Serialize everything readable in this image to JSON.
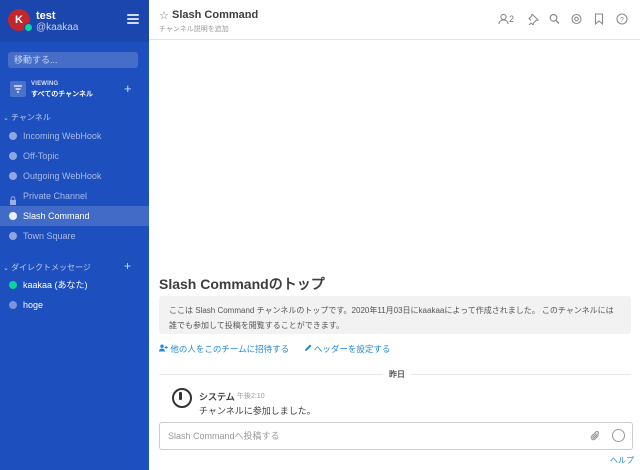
{
  "sidebar": {
    "avatar_initial": "K",
    "team_name": "test",
    "user_handle": "@kaakaa",
    "search_placeholder": "移動する...",
    "viewing_small": "VIEWING",
    "viewing_label": "すべてのチャンネル",
    "channels_title": "チャンネル",
    "channels": [
      {
        "label": "Incoming WebHook",
        "type": "public",
        "active": false
      },
      {
        "label": "Off-Topic",
        "type": "public",
        "active": false
      },
      {
        "label": "Outgoing WebHook",
        "type": "public",
        "active": false
      },
      {
        "label": "Private Channel",
        "type": "private",
        "active": false
      },
      {
        "label": "Slash Command",
        "type": "public",
        "active": true
      },
      {
        "label": "Town Square",
        "type": "public",
        "active": false
      }
    ],
    "dm_title": "ダイレクトメッセージ",
    "dms": [
      {
        "label": "kaakaa (あなた)",
        "status": "online"
      },
      {
        "label": "hoge",
        "status": "away"
      }
    ]
  },
  "header": {
    "title": "Slash Command",
    "purpose": "チャンネル説明を追加",
    "member_count": "2"
  },
  "intro": {
    "title": "Slash Commandのトップ",
    "text": "ここは Slash Command チャンネルのトップです。2020年11月03日にkaakaaによって作成されました。 このチャンネルには誰でも参加して投稿を閲覧することができます。",
    "invite_label": "他の人をこのチームに招待する",
    "header_label": "ヘッダーを設定する"
  },
  "date_separator": "昨日",
  "post": {
    "user": "システム",
    "time": "午後2:10",
    "message": "チャンネルに参加しました。"
  },
  "composer": {
    "placeholder": "Slash Commandへ投稿する"
  },
  "help_label": "ヘルプ",
  "colors": {
    "sidebar_bg": "#1e4fbe",
    "link": "#2389d7",
    "online": "#06d6a0"
  }
}
